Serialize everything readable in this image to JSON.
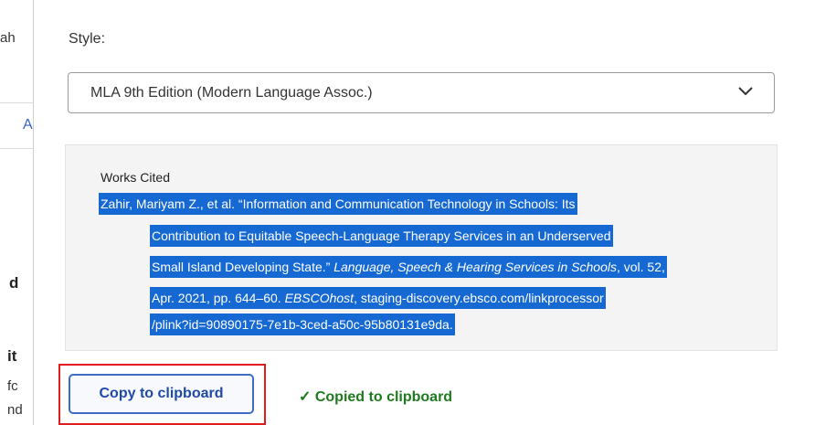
{
  "background_fragments": {
    "frag_1": "ah",
    "tab_letter": "A",
    "frag_2": "d",
    "frag_3": "it",
    "frag_4": "fc",
    "frag_5": "nd"
  },
  "dialog": {
    "style_label": "Style:",
    "style_select": {
      "value": "MLA 9th Edition (Modern Language Assoc.)",
      "icon": "chevron-down-icon"
    },
    "citation": {
      "heading": "Works Cited",
      "line_1": "Zahir, Mariyam Z., et al. “Information and Communication Technology in Schools: Its",
      "line_2": "Contribution to Equitable Speech-Language Therapy Services in an Underserved",
      "line_3_plain": "Small Island Developing State.” ",
      "line_3_italic": "Language, Speech & Hearing Services in Schools",
      "line_3_tail": ", vol. 52,",
      "line_4_plain": "Apr. 2021, pp. 644–60. ",
      "line_4_italic": "EBSCOhost",
      "line_4_tail": ", staging-discovery.ebsco.com/linkprocessor",
      "line_5": "/plink?id=90890175-7e1b-3ced-a50c-95b80131e9da."
    },
    "copy_button_label": "Copy to clipboard",
    "copied_status": "✓ Copied to clipboard"
  },
  "colors": {
    "selection_highlight": "#1669d2",
    "button_text": "#1f4aa8",
    "success_green": "#1e7a1e",
    "focus_outline": "#e01c1c"
  }
}
